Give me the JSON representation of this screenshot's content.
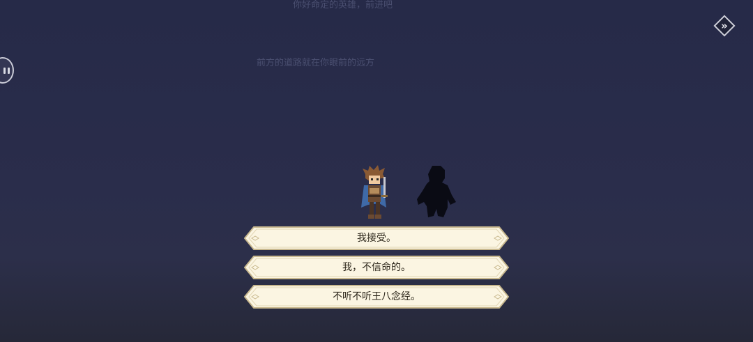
{
  "dialogue": {
    "faded_line_top": "你好命定的英雄，前进吧",
    "faded_line_mid": "前方的道路就在你眼前的远方"
  },
  "controls": {
    "pause_icon": "pause-icon",
    "skip_icon": "fast-forward-icon",
    "skip_glyph": "»"
  },
  "characters": {
    "hero": "hero-sprite",
    "mysterious": "shadow-silhouette"
  },
  "choices": [
    {
      "label": "我接受。"
    },
    {
      "label": "我，不信命的。"
    },
    {
      "label": "不听不听王八念经。"
    }
  ],
  "colors": {
    "background": "#292c4a",
    "choice_fill": "#fbf5e2",
    "choice_border": "#c9b98f",
    "text": "#2a2418"
  }
}
